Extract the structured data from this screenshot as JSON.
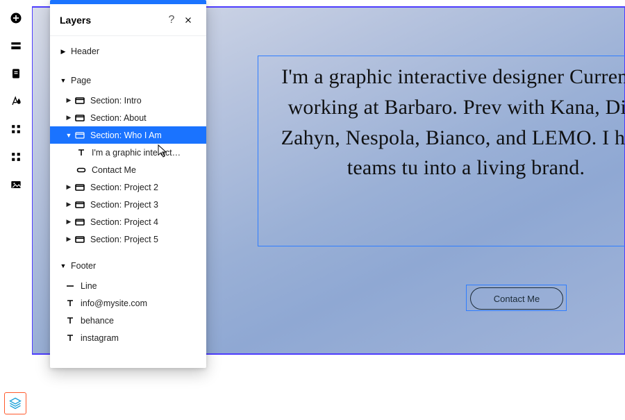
{
  "panel": {
    "title": "Layers",
    "groups": {
      "header": {
        "label": "Header"
      },
      "page": {
        "label": "Page"
      },
      "footer": {
        "label": "Footer"
      }
    },
    "page_items": [
      {
        "label": "Section: Intro",
        "expanded": false
      },
      {
        "label": "Section: About",
        "expanded": false
      },
      {
        "label": "Section: Who I Am",
        "expanded": true,
        "selected": true,
        "children": [
          {
            "type": "text",
            "label": "I'm a graphic interact…"
          },
          {
            "type": "button",
            "label": "Contact Me"
          }
        ]
      },
      {
        "label": "Section: Project 2",
        "expanded": false
      },
      {
        "label": "Section: Project 3",
        "expanded": false
      },
      {
        "label": "Section: Project 4",
        "expanded": false
      },
      {
        "label": "Section: Project 5",
        "expanded": false
      }
    ],
    "footer_items": [
      {
        "type": "line",
        "label": "Line"
      },
      {
        "type": "text",
        "label": "info@mysite.com"
      },
      {
        "type": "text",
        "label": "behance"
      },
      {
        "type": "text",
        "label": "instagram"
      }
    ]
  },
  "canvas": {
    "hero_text": "I'm a graphic interactive designer Currently working at Barbaro. Prev with Kana, Dih-Zahyn, Nespola, Bianco, and LEMO. I help teams tu into a living brand.",
    "button_label": "Contact Me"
  },
  "tools": {
    "add": "add-icon",
    "section": "section-icon",
    "page": "page-icon",
    "theme": "theme-icon",
    "apps": "apps-icon",
    "plugins": "plugins-icon",
    "media": "media-icon",
    "layers": "layers-icon"
  }
}
